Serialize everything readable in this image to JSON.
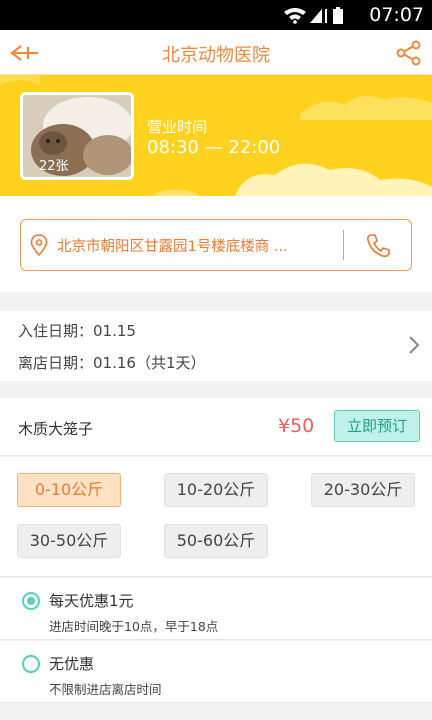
{
  "status_bar": {
    "time": "07:07"
  },
  "nav": {
    "title": "北京动物医院"
  },
  "banner": {
    "photo_count": "22张",
    "hours_label": "营业时间",
    "hours_value": "08:30 — 22:00"
  },
  "address": {
    "text": "北京市朝阳区甘露园1号楼底楼商 ..."
  },
  "dates": {
    "checkin": "入住日期：01.15",
    "checkout": "离店日期：01.16（共1天）"
  },
  "cage": {
    "name": "木质大笼子",
    "price": "¥50",
    "book_label": "立即预订"
  },
  "weights": [
    "0-10公斤",
    "10-20公斤",
    "20-30公斤",
    "30-50公斤",
    "50-60公斤"
  ],
  "selected_weight": "0-10公斤",
  "discounts": [
    {
      "title": "每天优惠1元",
      "desc": "进店时间晚于10点，早于18点",
      "selected": true
    },
    {
      "title": "无优惠",
      "desc": "不限制进店离店时间",
      "selected": false
    }
  ],
  "colors": {
    "accent": "#f08a3e",
    "banner": "#ffd21f",
    "teal": "#55d0bb",
    "price": "#f45c5c"
  }
}
